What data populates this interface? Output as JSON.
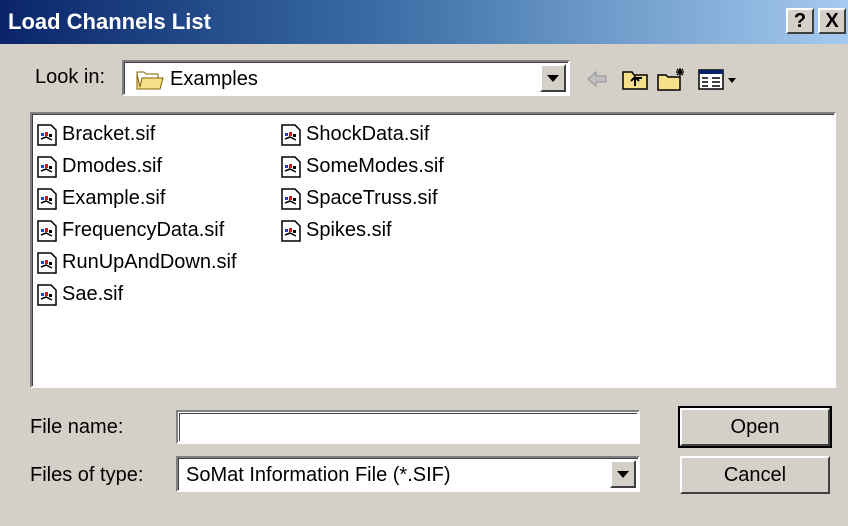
{
  "dialog": {
    "title": "Load Channels List",
    "help_label": "?",
    "close_label": "X"
  },
  "lookin": {
    "label": "Look in:",
    "value": "Examples"
  },
  "files": [
    {
      "name": "Bracket.sif"
    },
    {
      "name": "Dmodes.sif"
    },
    {
      "name": "Example.sif"
    },
    {
      "name": "FrequencyData.sif"
    },
    {
      "name": "RunUpAndDown.sif"
    },
    {
      "name": "Sae.sif"
    },
    {
      "name": "ShockData.sif"
    },
    {
      "name": "SomeModes.sif"
    },
    {
      "name": "SpaceTruss.sif"
    },
    {
      "name": "Spikes.sif"
    }
  ],
  "filename": {
    "label": "File name:",
    "value": ""
  },
  "filetype": {
    "label": "Files of type:",
    "value": "SoMat Information File (*.SIF)"
  },
  "buttons": {
    "open": "Open",
    "cancel": "Cancel"
  },
  "icons": {
    "folder": "folder-icon",
    "back": "back-arrow-icon",
    "up": "up-one-level-icon",
    "new_folder": "new-folder-icon",
    "view_menu": "view-menu-icon",
    "file": "sif-file-icon"
  },
  "colors": {
    "titlebar_start": "#0a246a",
    "titlebar_end": "#a6caf0",
    "face": "#d4d0c8"
  }
}
